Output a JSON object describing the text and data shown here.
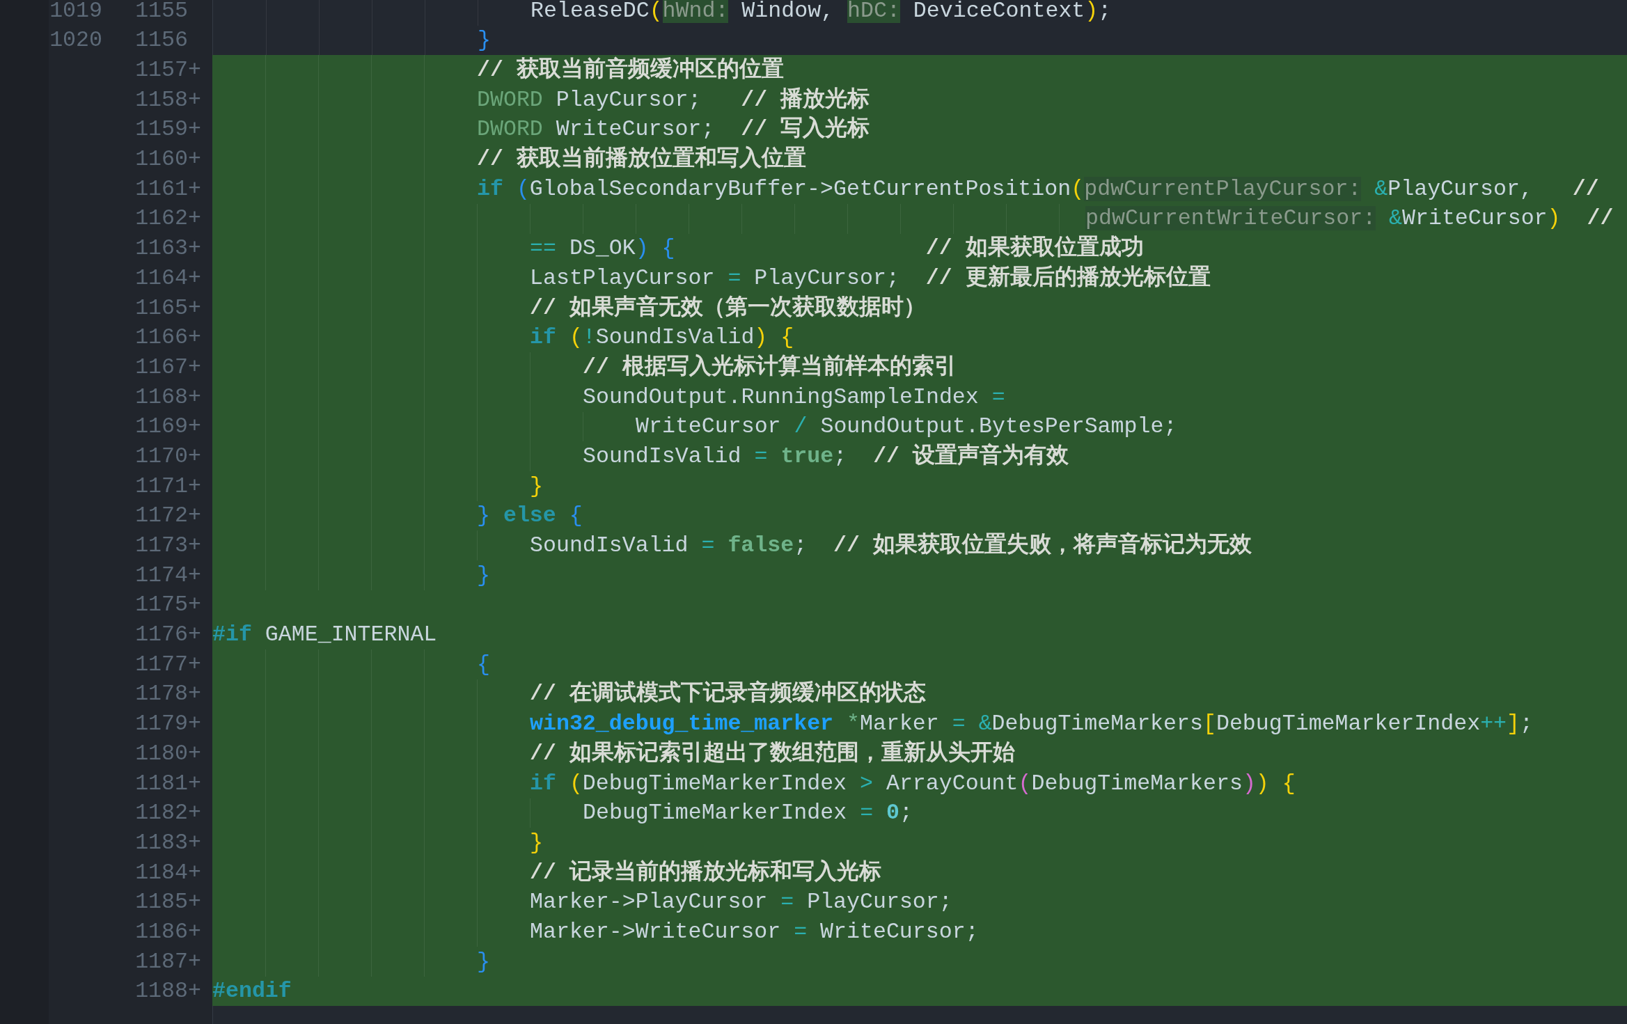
{
  "diff_lines": [
    {
      "old": "1019",
      "new": "1155",
      "added": false,
      "tokens": [
        {
          "text": "                        ReleaseDC",
          "kind": "plain"
        },
        {
          "text": "(",
          "kind": "yellow"
        },
        {
          "text": "hWnd:",
          "kind": "hint"
        },
        {
          "text": " Window, ",
          "kind": "plain"
        },
        {
          "text": "hDC:",
          "kind": "hint"
        },
        {
          "text": " DeviceContext",
          "kind": "plain"
        },
        {
          "text": ")",
          "kind": "yellow"
        },
        {
          "text": ";",
          "kind": "plain"
        }
      ]
    },
    {
      "old": "1020",
      "new": "1156",
      "added": false,
      "tokens": [
        {
          "text": "                    }",
          "kind": "blue"
        }
      ]
    },
    {
      "new": "1157",
      "marker": "+",
      "added": true,
      "tokens": [
        {
          "text": "                    // 获取当前音频缓冲区的位置",
          "kind": "comment"
        }
      ]
    },
    {
      "new": "1158",
      "marker": "+",
      "added": true,
      "tokens": [
        {
          "text": "                    DWORD",
          "kind": "type"
        },
        {
          "text": " PlayCursor;   ",
          "kind": "plain"
        },
        {
          "text": "// 播放光标",
          "kind": "comment"
        }
      ]
    },
    {
      "new": "1159",
      "marker": "+",
      "added": true,
      "tokens": [
        {
          "text": "                    DWORD",
          "kind": "type"
        },
        {
          "text": " WriteCursor;  ",
          "kind": "plain"
        },
        {
          "text": "// 写入光标",
          "kind": "comment"
        }
      ]
    },
    {
      "new": "1160",
      "marker": "+",
      "added": true,
      "tokens": [
        {
          "text": "                    // 获取当前播放位置和写入位置",
          "kind": "comment"
        }
      ]
    },
    {
      "new": "1161",
      "marker": "+",
      "added": true,
      "tokens": [
        {
          "text": "                    if ",
          "kind": "keyword"
        },
        {
          "text": "(",
          "kind": "blue"
        },
        {
          "text": "GlobalSecondaryBuffer->GetCurrentPosition",
          "kind": "plain"
        },
        {
          "text": "(",
          "kind": "yellow"
        },
        {
          "text": "pdwCurrentPlayCursor:",
          "kind": "hint"
        },
        {
          "text": " &",
          "kind": "op"
        },
        {
          "text": "PlayCursor,   ",
          "kind": "plain"
        },
        {
          "text": "//",
          "kind": "comment"
        }
      ]
    },
    {
      "new": "1162",
      "marker": "+",
      "added": true,
      "tokens": [
        {
          "text": "                                                                  pdwCurrentWriteCursor:",
          "kind": "hint"
        },
        {
          "text": " &",
          "kind": "op"
        },
        {
          "text": "WriteCursor",
          "kind": "plain"
        },
        {
          "text": ")  ",
          "kind": "yellow"
        },
        {
          "text": "//",
          "kind": "comment"
        }
      ]
    },
    {
      "new": "1163",
      "marker": "+",
      "added": true,
      "tokens": [
        {
          "text": "                        ==",
          "kind": "op"
        },
        {
          "text": " DS_OK",
          "kind": "plain"
        },
        {
          "text": ") ",
          "kind": "blue"
        },
        {
          "text": "{                   ",
          "kind": "blue"
        },
        {
          "text": "// 如果获取位置成功",
          "kind": "comment"
        }
      ]
    },
    {
      "new": "1164",
      "marker": "+",
      "added": true,
      "tokens": [
        {
          "text": "                        LastPlayCursor ",
          "kind": "plain"
        },
        {
          "text": "=",
          "kind": "op"
        },
        {
          "text": " PlayCursor;  ",
          "kind": "plain"
        },
        {
          "text": "// 更新最后的播放光标位置",
          "kind": "comment"
        }
      ]
    },
    {
      "new": "1165",
      "marker": "+",
      "added": true,
      "tokens": [
        {
          "text": "                        // 如果声音无效（第一次获取数据时）",
          "kind": "comment"
        }
      ]
    },
    {
      "new": "1166",
      "marker": "+",
      "added": true,
      "tokens": [
        {
          "text": "                        if ",
          "kind": "keyword"
        },
        {
          "text": "(",
          "kind": "yellow"
        },
        {
          "text": "!",
          "kind": "op"
        },
        {
          "text": "SoundIsValid",
          "kind": "plain"
        },
        {
          "text": ") ",
          "kind": "yellow"
        },
        {
          "text": "{",
          "kind": "yellow"
        }
      ]
    },
    {
      "new": "1167",
      "marker": "+",
      "added": true,
      "tokens": [
        {
          "text": "                            // 根据写入光标计算当前样本的索引",
          "kind": "comment"
        }
      ]
    },
    {
      "new": "1168",
      "marker": "+",
      "added": true,
      "tokens": [
        {
          "text": "                            SoundOutput.RunningSampleIndex ",
          "kind": "plain"
        },
        {
          "text": "=",
          "kind": "op"
        }
      ]
    },
    {
      "new": "1169",
      "marker": "+",
      "added": true,
      "tokens": [
        {
          "text": "                                WriteCursor ",
          "kind": "plain"
        },
        {
          "text": "/",
          "kind": "op"
        },
        {
          "text": " SoundOutput.BytesPerSample;",
          "kind": "plain"
        }
      ]
    },
    {
      "new": "1170",
      "marker": "+",
      "added": true,
      "tokens": [
        {
          "text": "                            SoundIsValid ",
          "kind": "plain"
        },
        {
          "text": "= ",
          "kind": "op"
        },
        {
          "text": "true",
          "kind": "bool"
        },
        {
          "text": ";  ",
          "kind": "plain"
        },
        {
          "text": "// 设置声音为有效",
          "kind": "comment"
        }
      ]
    },
    {
      "new": "1171",
      "marker": "+",
      "added": true,
      "tokens": [
        {
          "text": "                        }",
          "kind": "yellow"
        }
      ]
    },
    {
      "new": "1172",
      "marker": "+",
      "added": true,
      "tokens": [
        {
          "text": "                    } ",
          "kind": "blue"
        },
        {
          "text": "else ",
          "kind": "keyword"
        },
        {
          "text": "{",
          "kind": "blue"
        }
      ]
    },
    {
      "new": "1173",
      "marker": "+",
      "added": true,
      "tokens": [
        {
          "text": "                        SoundIsValid ",
          "kind": "plain"
        },
        {
          "text": "= ",
          "kind": "op"
        },
        {
          "text": "false",
          "kind": "bool"
        },
        {
          "text": ";  ",
          "kind": "plain"
        },
        {
          "text": "// 如果获取位置失败，将声音标记为无效",
          "kind": "comment"
        }
      ]
    },
    {
      "new": "1174",
      "marker": "+",
      "added": true,
      "tokens": [
        {
          "text": "                    }",
          "kind": "blue"
        }
      ]
    },
    {
      "new": "1175",
      "marker": "+",
      "added": true
    },
    {
      "new": "1176",
      "marker": "+",
      "added": true,
      "tokens": [
        {
          "text": "#if",
          "kind": "preproc"
        },
        {
          "text": " GAME_INTERNAL",
          "kind": "plain"
        }
      ]
    },
    {
      "new": "1177",
      "marker": "+",
      "added": true,
      "tokens": [
        {
          "text": "                    {",
          "kind": "blue"
        }
      ]
    },
    {
      "new": "1178",
      "marker": "+",
      "added": true,
      "tokens": [
        {
          "text": "                        // 在调试模式下记录音频缓冲区的状态",
          "kind": "comment"
        }
      ]
    },
    {
      "new": "1179",
      "marker": "+",
      "added": true,
      "tokens": [
        {
          "text": "                        win32_debug_time_marker",
          "kind": "typename"
        },
        {
          "text": " *",
          "kind": "ptr"
        },
        {
          "text": "Marker ",
          "kind": "plain"
        },
        {
          "text": "= &",
          "kind": "op"
        },
        {
          "text": "DebugTimeMarkers",
          "kind": "plain"
        },
        {
          "text": "[",
          "kind": "yellow"
        },
        {
          "text": "DebugTimeMarkerIndex",
          "kind": "plain"
        },
        {
          "text": "++",
          "kind": "op"
        },
        {
          "text": "]",
          "kind": "yellow"
        },
        {
          "text": ";",
          "kind": "plain"
        }
      ]
    },
    {
      "new": "1180",
      "marker": "+",
      "added": true,
      "tokens": [
        {
          "text": "                        // 如果标记索引超出了数组范围，重新从头开始",
          "kind": "comment"
        }
      ]
    },
    {
      "new": "1181",
      "marker": "+",
      "added": true,
      "tokens": [
        {
          "text": "                        if ",
          "kind": "keyword"
        },
        {
          "text": "(",
          "kind": "yellow"
        },
        {
          "text": "DebugTimeMarkerIndex ",
          "kind": "plain"
        },
        {
          "text": ">",
          "kind": "op"
        },
        {
          "text": " ArrayCount",
          "kind": "plain"
        },
        {
          "text": "(",
          "kind": "pink"
        },
        {
          "text": "DebugTimeMarkers",
          "kind": "plain"
        },
        {
          "text": ")",
          "kind": "pink"
        },
        {
          "text": ") ",
          "kind": "yellow"
        },
        {
          "text": "{",
          "kind": "yellow"
        }
      ]
    },
    {
      "new": "1182",
      "marker": "+",
      "added": true,
      "tokens": [
        {
          "text": "                            DebugTimeMarkerIndex ",
          "kind": "plain"
        },
        {
          "text": "= ",
          "kind": "op"
        },
        {
          "text": "0",
          "kind": "number"
        },
        {
          "text": ";",
          "kind": "plain"
        }
      ]
    },
    {
      "new": "1183",
      "marker": "+",
      "added": true,
      "tokens": [
        {
          "text": "                        }",
          "kind": "yellow"
        }
      ]
    },
    {
      "new": "1184",
      "marker": "+",
      "added": true,
      "tokens": [
        {
          "text": "                        // 记录当前的播放光标和写入光标",
          "kind": "comment"
        }
      ]
    },
    {
      "new": "1185",
      "marker": "+",
      "added": true,
      "tokens": [
        {
          "text": "                        Marker->PlayCursor ",
          "kind": "plain"
        },
        {
          "text": "=",
          "kind": "op"
        },
        {
          "text": " PlayCursor;",
          "kind": "plain"
        }
      ]
    },
    {
      "new": "1186",
      "marker": "+",
      "added": true,
      "tokens": [
        {
          "text": "                        Marker->WriteCursor ",
          "kind": "plain"
        },
        {
          "text": "=",
          "kind": "op"
        },
        {
          "text": " WriteCursor;",
          "kind": "plain"
        }
      ]
    },
    {
      "new": "1187",
      "marker": "+",
      "added": true,
      "tokens": [
        {
          "text": "                    }",
          "kind": "blue"
        }
      ]
    },
    {
      "new": "1188",
      "marker": "+",
      "added": true,
      "tokens": [
        {
          "text": "#endif",
          "kind": "preproc"
        }
      ]
    },
    {
      "added": false
    }
  ]
}
